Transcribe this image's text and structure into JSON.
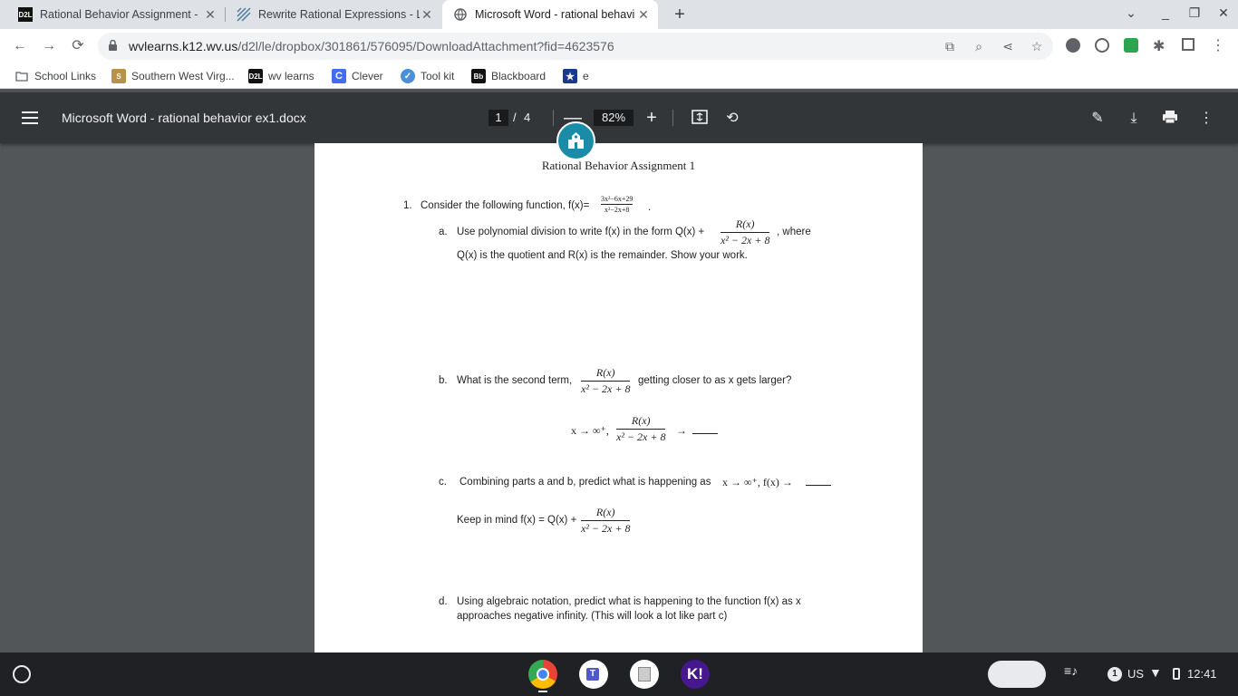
{
  "browser": {
    "tabs": [
      {
        "title": "Rational Behavior Assignment -",
        "favicon_text": "D2L",
        "active": false
      },
      {
        "title": "Rewrite Rational Expressions - L",
        "favicon_text": "",
        "active": false
      },
      {
        "title": "Microsoft Word - rational behavi",
        "favicon_text": "",
        "active": true
      }
    ],
    "new_tab_label": "+",
    "url_host": "wvlearns.k12.wv.us",
    "url_path": "/d2l/le/dropbox/301861/576095/DownloadAttachment?fid=4623576",
    "bookmarks": [
      {
        "label": "School Links",
        "icon": "folder-icon"
      },
      {
        "label": "Southern West Virg...",
        "icon": "swv-icon"
      },
      {
        "label": "wv learns",
        "icon": "d2l-icon"
      },
      {
        "label": "Clever",
        "icon": "clever-icon"
      },
      {
        "label": "Tool kit",
        "icon": "toolkit-icon"
      },
      {
        "label": "Blackboard",
        "icon": "blackboard-icon"
      },
      {
        "label": "e",
        "icon": "star-badge-icon"
      }
    ],
    "bookmark_icon_text": {
      "d2l": "D2L",
      "clever": "C",
      "blackboard": "Bb"
    }
  },
  "pdf": {
    "title": "Microsoft Word - rational behavior ex1.docx",
    "page_current": "1",
    "page_sep": "/",
    "page_total": "4",
    "zoom": "82%",
    "zoom_out": "—",
    "zoom_in": "+"
  },
  "document": {
    "heading": "Rational Behavior Assignment 1",
    "q1_num": "1.",
    "q1_text": "Consider the following function, f(x)=",
    "q1_frac_num": "3x²−6x+29",
    "q1_frac_den": "x²−2x+8",
    "q1_end": ".",
    "a_label": "a.",
    "a_text1": "Use polynomial division to write f(x) in the form Q(x) +",
    "rx": "R(x)",
    "denom": "x² − 2x + 8",
    "a_text2": ", where",
    "a_text3": "Q(x) is the quotient and R(x) is the remainder.  Show your work.",
    "b_label": "b.",
    "b_text1": "What is the second term,",
    "b_text2": "getting closer to as x gets larger?",
    "b_limit": "x → ∞⁺,",
    "b_arrow": "→",
    "c_label": "c.",
    "c_text": "Combining parts a and b, predict what is happening as",
    "c_math": "x → ∞⁺, f(x) →",
    "c_text2": "Keep in mind f(x) = Q(x) +",
    "d_label": "d.",
    "d_text1": "Using algebraic notation, predict what is happening to the function f(x) as x",
    "d_text2": "approaches negative infinity.  (This will look a lot like part c)"
  },
  "shelf": {
    "locale": "US",
    "time": "12:41",
    "notification_count": "1",
    "apps": [
      "chrome-icon",
      "teams-icon",
      "pdf-app-icon",
      "kahoot-icon"
    ],
    "kahoot_label": "K!"
  }
}
